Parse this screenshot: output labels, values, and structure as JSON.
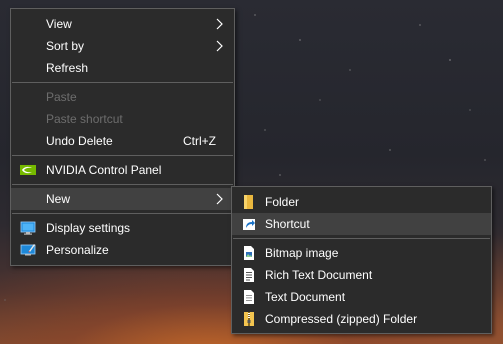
{
  "main_menu": {
    "view": "View",
    "sort_by": "Sort by",
    "refresh": "Refresh",
    "paste": "Paste",
    "paste_shortcut": "Paste shortcut",
    "undo_delete": "Undo Delete",
    "undo_delete_shortcut": "Ctrl+Z",
    "nvidia": "NVIDIA Control Panel",
    "new": "New",
    "display_settings": "Display settings",
    "personalize": "Personalize"
  },
  "new_submenu": {
    "folder": "Folder",
    "shortcut": "Shortcut",
    "bitmap": "Bitmap image",
    "rtf": "Rich Text Document",
    "text": "Text Document",
    "zip": "Compressed (zipped) Folder"
  },
  "icons": {
    "nvidia": "nvidia-icon",
    "display": "display-settings-icon",
    "personalize": "personalize-icon",
    "folder": "folder-icon",
    "shortcut": "shortcut-icon",
    "bitmap": "bitmap-document-icon",
    "rtf": "rich-text-document-icon",
    "text": "text-document-icon",
    "zip": "zipped-folder-icon"
  },
  "colors": {
    "menu_bg": "#2b2b2b",
    "menu_border": "#5f5f5f",
    "hover_bg": "#414141",
    "text": "#ffffff",
    "disabled_text": "#6d6d6d",
    "nvidia_green": "#76b900",
    "folder_yellow": "#f3c44f"
  }
}
